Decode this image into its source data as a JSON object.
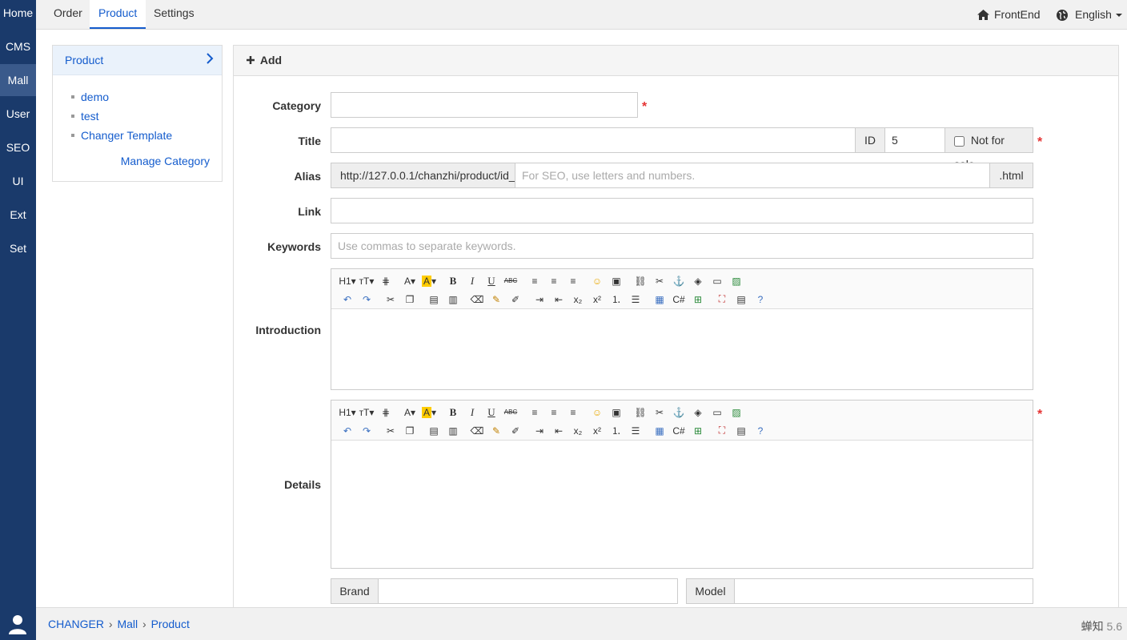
{
  "leftnav": {
    "items": [
      "Home",
      "CMS",
      "Mall",
      "User",
      "SEO",
      "UI",
      "Ext",
      "Set"
    ],
    "active_index": 2
  },
  "topbar": {
    "tabs": [
      "Order",
      "Product",
      "Settings"
    ],
    "active_tab": "Product",
    "frontend_label": "FrontEnd",
    "language_label": "English"
  },
  "sidebar": {
    "title": "Product",
    "categories": [
      "demo",
      "test",
      "Changer Template"
    ],
    "manage_label": "Manage Category"
  },
  "form": {
    "header": "Add",
    "category_label": "Category",
    "title_label": "Title",
    "id_label": "ID",
    "id_value": "5",
    "not_for_sale_label": "Not for sale",
    "alias_label": "Alias",
    "alias_prefix": "http://127.0.0.1/chanzhi/product/id_",
    "alias_placeholder": "For SEO, use letters and numbers.",
    "alias_suffix": ".html",
    "link_label": "Link",
    "keywords_label": "Keywords",
    "keywords_placeholder": "Use commas to separate keywords.",
    "introduction_label": "Introduction",
    "details_label": "Details",
    "brand_label": "Brand",
    "model_label": "Model",
    "required_mark": "*"
  },
  "statusbar": {
    "breadcrumb": [
      "CHANGER",
      "Mall",
      "Product"
    ],
    "brand": "蝉知",
    "version": "5.6"
  }
}
